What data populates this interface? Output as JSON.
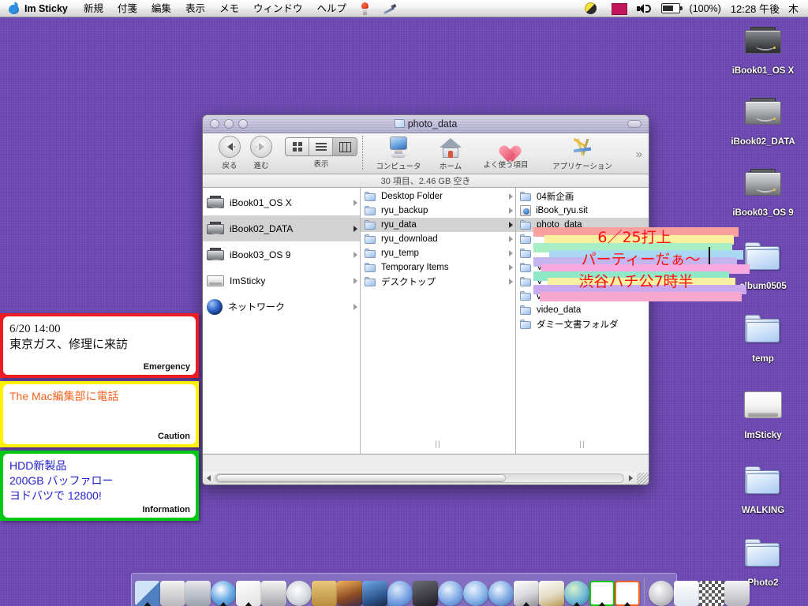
{
  "menubar": {
    "apple_icon": "apple-logo",
    "app_name": "Im Sticky",
    "menus": [
      "新規",
      "付箋",
      "編集",
      "表示",
      "メモ",
      "ウィンドウ",
      "ヘルプ"
    ],
    "extra_icons": [
      "red-stamp-icon",
      "pen-icon"
    ],
    "status_icons": [
      "yinyang-icon",
      "flag-icon",
      "speaker-icon",
      "battery-icon"
    ],
    "battery_percent": "(100%)",
    "clock": "12:28 午後",
    "weekday": "木"
  },
  "desktop_icons": [
    {
      "label": "iBook01_OS X",
      "type": "harddrive-dark"
    },
    {
      "label": "iBook02_DATA",
      "type": "harddrive"
    },
    {
      "label": "iBook03_OS 9",
      "type": "harddrive"
    },
    {
      "label": "album0505",
      "type": "folder"
    },
    {
      "label": "temp",
      "type": "folder"
    },
    {
      "label": "ImSticky",
      "type": "removable-drive"
    },
    {
      "label": "WALKING",
      "type": "folder"
    },
    {
      "label": "Photo2",
      "type": "folder"
    }
  ],
  "finder": {
    "title": "photo_data",
    "title_icon": "folder-icon",
    "window_buttons": [
      "close-button",
      "minimize-button",
      "zoom-button"
    ],
    "toolbar": {
      "back_label": "戻る",
      "forward_label": "進む",
      "view_label": "表示",
      "view_modes": [
        "icon-view",
        "list-view",
        "column-view"
      ],
      "items": [
        {
          "label": "コンピュータ",
          "icon": "computer-icon"
        },
        {
          "label": "ホーム",
          "icon": "home-icon"
        },
        {
          "label": "よく使う項目",
          "icon": "heart-icon"
        },
        {
          "label": "アプリケーション",
          "icon": "applications-icon"
        }
      ],
      "overflow": "»"
    },
    "status": "30 項目、2.46 GB 空き",
    "columns": [
      {
        "name": "volumes-column",
        "items": [
          {
            "label": "iBook01_OS X",
            "icon": "harddrive-icon",
            "has_arrow": true,
            "selected": false
          },
          {
            "label": "iBook02_DATA",
            "icon": "harddrive-icon",
            "has_arrow": true,
            "selected": true
          },
          {
            "label": "iBook03_OS 9",
            "icon": "harddrive-icon",
            "has_arrow": true,
            "selected": false
          },
          {
            "label": "ImSticky",
            "icon": "removable-drive-icon",
            "has_arrow": true,
            "selected": false
          },
          {
            "label": "ネットワーク",
            "icon": "network-globe-icon",
            "has_arrow": true,
            "selected": false
          }
        ]
      },
      {
        "name": "folders-column",
        "items": [
          {
            "label": "Desktop Folder",
            "icon": "folder-icon",
            "has_arrow": true,
            "selected": false
          },
          {
            "label": "ryu_backup",
            "icon": "folder-icon",
            "has_arrow": true,
            "selected": false
          },
          {
            "label": "ryu_data",
            "icon": "folder-icon",
            "has_arrow": true,
            "selected": true
          },
          {
            "label": "ryu_download",
            "icon": "folder-icon",
            "has_arrow": true,
            "selected": false
          },
          {
            "label": "ryu_temp",
            "icon": "folder-icon",
            "has_arrow": true,
            "selected": false
          },
          {
            "label": "Temporary Items",
            "icon": "folder-icon",
            "has_arrow": true,
            "selected": false
          },
          {
            "label": "デスクトップ",
            "icon": "folder-icon",
            "has_arrow": true,
            "selected": false
          }
        ]
      },
      {
        "name": "contents-column",
        "items": [
          {
            "label": "04新企画",
            "icon": "folder-icon",
            "has_arrow": false,
            "selected": false
          },
          {
            "label": "iBook_ryu.sit",
            "icon": "archive-file-icon",
            "has_arrow": false,
            "selected": false
          },
          {
            "label": "photo_data",
            "icon": "folder-icon",
            "has_arrow": false,
            "selected": true
          },
          {
            "label": "",
            "icon": "folder-icon",
            "has_arrow": false,
            "selected": false
          },
          {
            "label": "",
            "icon": "folder-icon",
            "has_arrow": false,
            "selected": false
          },
          {
            "label": "Vect",
            "icon": "folder-icon",
            "has_arrow": false,
            "selected": false
          },
          {
            "label": "V",
            "icon": "folder-icon",
            "has_arrow": false,
            "selected": false
          },
          {
            "label": "vector原稿2004",
            "icon": "folder-icon",
            "has_arrow": false,
            "selected": false
          },
          {
            "label": "video_data",
            "icon": "folder-icon",
            "has_arrow": false,
            "selected": false
          },
          {
            "label": "ダミー文書フォルダ",
            "icon": "folder-icon",
            "has_arrow": false,
            "selected": false
          }
        ]
      }
    ]
  },
  "sticky_notes": [
    {
      "id": "emergency",
      "border_color": "#ED1C24",
      "text_color": "#111111",
      "tag": "Emergency",
      "lines": [
        "6/20 14:00",
        "東京ガス、修理に来訪"
      ]
    },
    {
      "id": "caution",
      "border_color": "#FFF200",
      "text_color": "#F26522",
      "tag": "Caution",
      "lines": [
        "The Mac編集部に電話"
      ]
    },
    {
      "id": "information",
      "border_color": "#00C814",
      "text_color": "#2222CC",
      "tag": "Information",
      "lines": [
        "HDD新製品",
        "200GB バッファロー",
        "ヨドバツで 12800!"
      ]
    }
  ],
  "stripe_note": {
    "text_color": "#FF1010",
    "lines": [
      "6／25打上",
      "パーティーだぁ～",
      "渋谷ハチ公7時半"
    ],
    "stripe_colors": [
      "#F9A1A0",
      "#FAF1A0",
      "#A8EFC6",
      "#A9D8F2",
      "#C4B5EE",
      "#F8A9E0",
      "#8FE8C8",
      "#F6F1A2",
      "#CBA9EE",
      "#F6A8CE"
    ]
  },
  "dock": {
    "items": [
      {
        "name": "finder",
        "running": true
      },
      {
        "name": "system-preferences",
        "running": false
      },
      {
        "name": "mail",
        "running": false
      },
      {
        "name": "safari",
        "running": true
      },
      {
        "name": "textedit",
        "running": true
      },
      {
        "name": "printer",
        "running": false
      },
      {
        "name": "itunes",
        "running": false
      },
      {
        "name": "address-book",
        "running": false
      },
      {
        "name": "iphoto",
        "running": false
      },
      {
        "name": "imovie",
        "running": false
      },
      {
        "name": "ichat",
        "running": false
      },
      {
        "name": "quicktime-black",
        "running": false
      },
      {
        "name": "sherlock",
        "running": false
      },
      {
        "name": "quicktime",
        "running": false
      },
      {
        "name": "internet-explorer",
        "running": false
      },
      {
        "name": "graphic-converter",
        "running": true
      },
      {
        "name": "stuffit",
        "running": false
      },
      {
        "name": "world-app",
        "running": true
      },
      {
        "name": "im-sticky-creator",
        "running": true
      },
      {
        "name": "im-sticky",
        "running": true
      }
    ],
    "trash_group": [
      {
        "name": "mail-at-icon"
      },
      {
        "name": "document-window"
      },
      {
        "name": "checker-pattern"
      },
      {
        "name": "trash"
      }
    ],
    "separator": "dock-separator"
  }
}
